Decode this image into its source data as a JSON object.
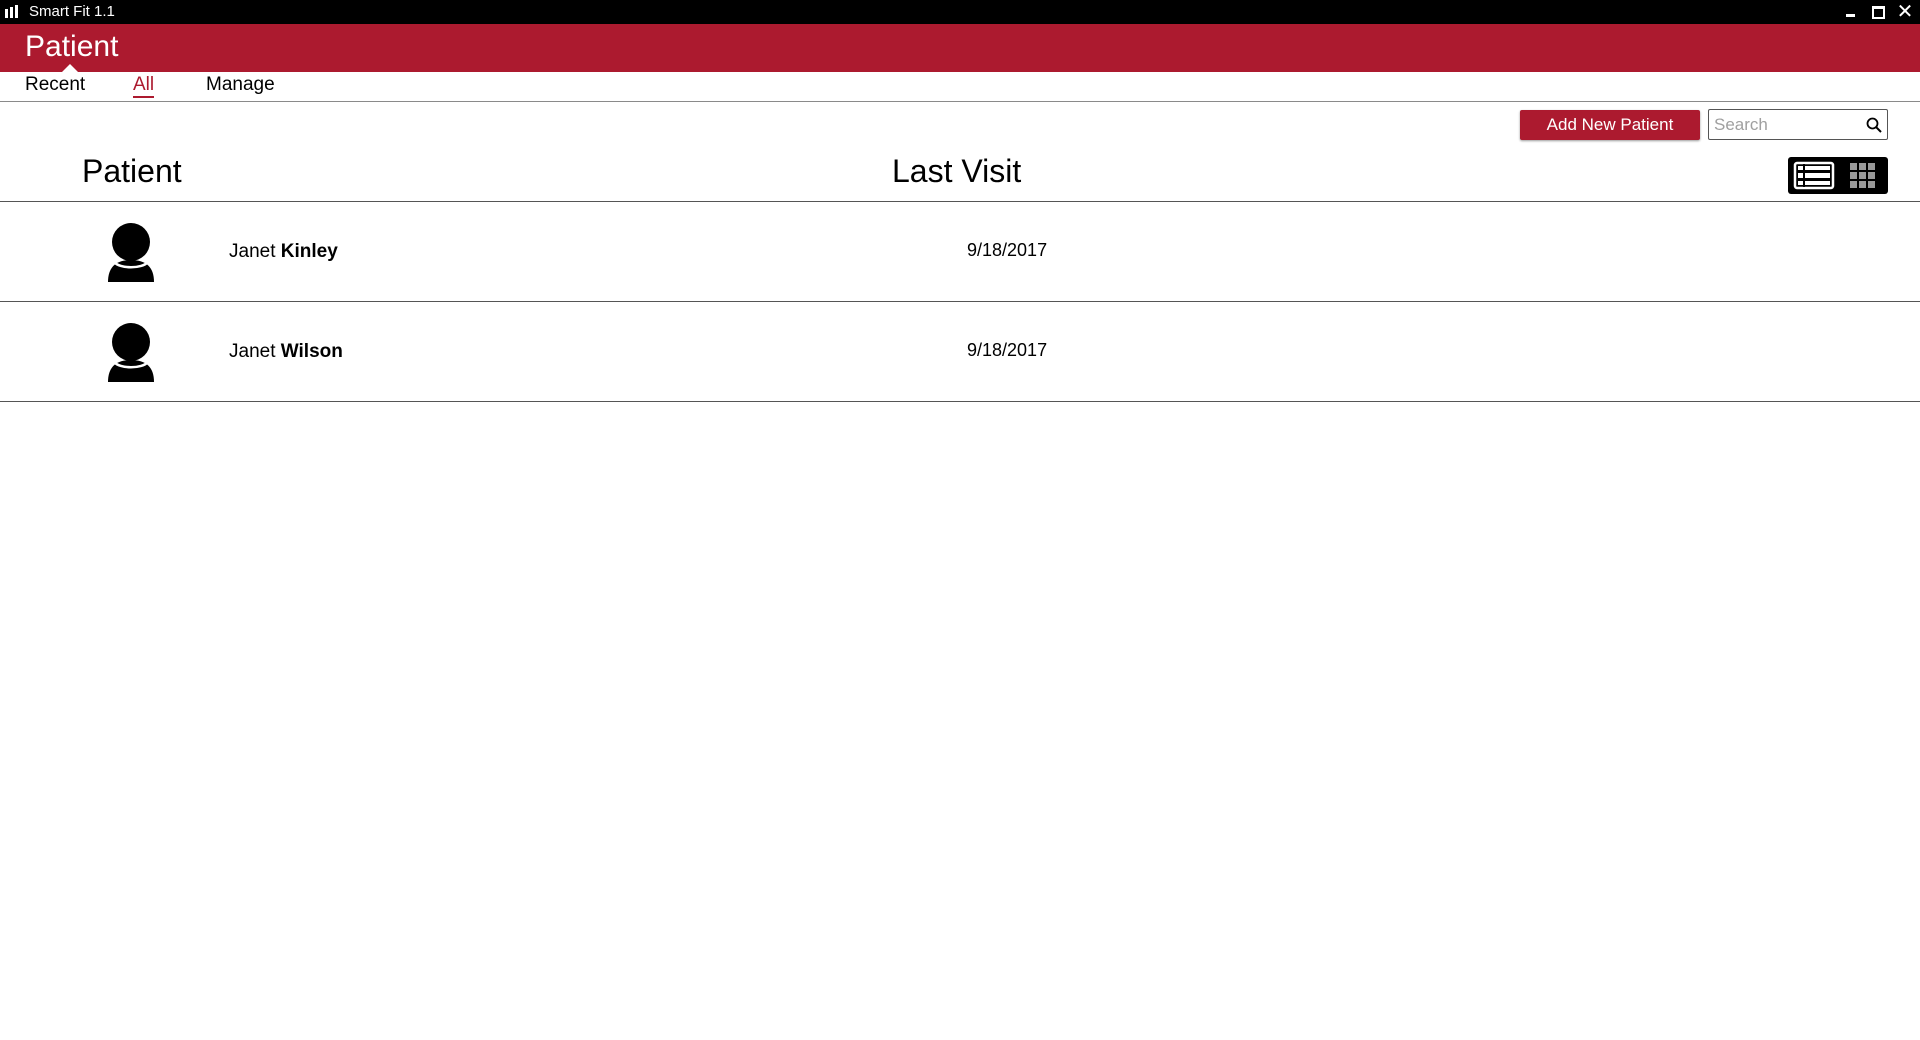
{
  "window": {
    "title": "Smart Fit 1.1",
    "close_glyph": "✕"
  },
  "header": {
    "title": "Patient"
  },
  "tabs": [
    {
      "label": "Recent",
      "active": false
    },
    {
      "label": "All",
      "active": true
    },
    {
      "label": "Manage",
      "active": false
    }
  ],
  "toolbar": {
    "add_label": "Add New Patient",
    "search_placeholder": "Search",
    "search_value": ""
  },
  "table": {
    "columns": [
      "Patient",
      "Last Visit"
    ],
    "view_mode": "list",
    "rows": [
      {
        "first_name": "Janet",
        "last_name": "Kinley",
        "last_visit": "9/18/2017"
      },
      {
        "first_name": "Janet",
        "last_name": "Wilson",
        "last_visit": "9/18/2017"
      }
    ]
  },
  "colors": {
    "accent": "#ac1a2f",
    "titlebar": "#000000",
    "background": "#ffffff"
  },
  "icons": {
    "app_logo": "bar-chart-icon",
    "search": "search-icon",
    "avatar": "user-icon",
    "list_view": "list-view-icon",
    "grid_view": "grid-view-icon"
  }
}
